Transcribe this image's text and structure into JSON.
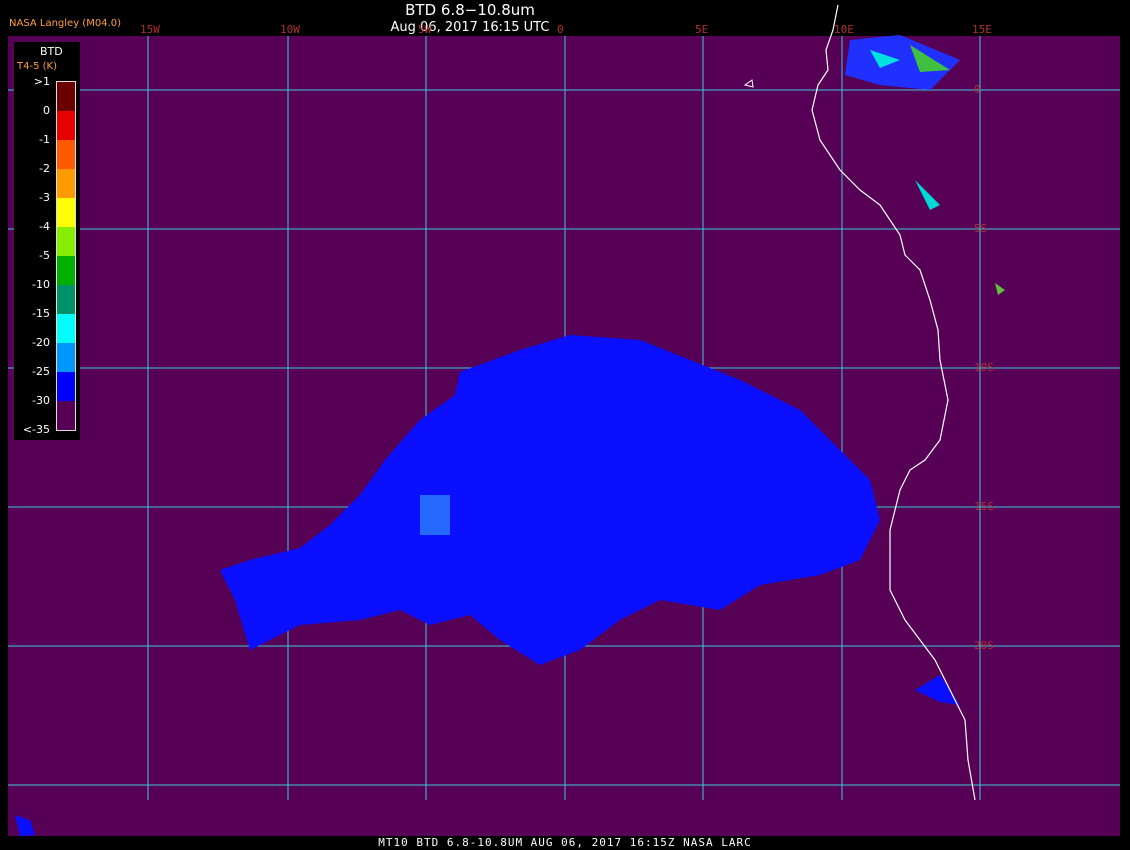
{
  "title": "BTD 6.8−10.8um",
  "subtitle": "Aug 06, 2017 16:15 UTC",
  "org": "NASA Langley (M04.0)",
  "legend": {
    "title": "BTD",
    "subtitle": "T4-5 (K)",
    "labels": [
      ">1",
      "0",
      "-1",
      "-2",
      "-3",
      "-4",
      "-5",
      "-10",
      "-15",
      "-20",
      "-25",
      "-30",
      "<-35"
    ],
    "colors": [
      "#6a0000",
      "#e60000",
      "#ff5a00",
      "#ff9a00",
      "#ffff00",
      "#88ee00",
      "#00b000",
      "#00906a",
      "#00ffff",
      "#0096ff",
      "#0000ff",
      "#560056"
    ]
  },
  "longitudes": [
    "15W",
    "10W",
    "5W",
    "0",
    "5E",
    "10E",
    "15E"
  ],
  "latitudes": [
    "0",
    "5S",
    "10S",
    "15S",
    "20S"
  ],
  "footer": "MT10  BTD 6.8-10.8UM  AUG 06, 2017 16:15Z  NASA LARC",
  "colors": {
    "background": "#560056",
    "grid": "#3cc8dc",
    "coast": "#ffffff",
    "cloud": "#0a10ff"
  }
}
